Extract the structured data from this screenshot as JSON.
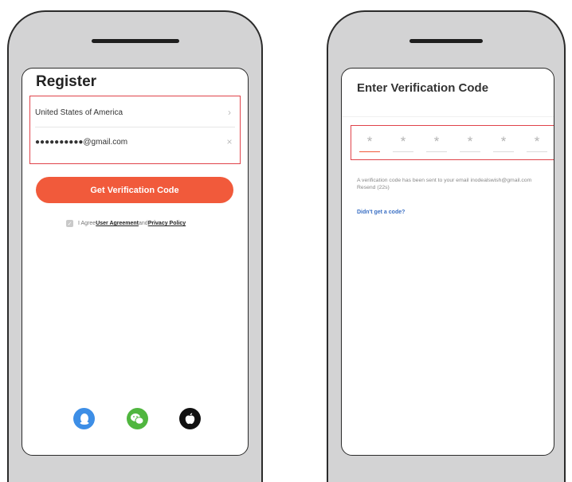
{
  "register": {
    "title": "Register",
    "country": "United States of America",
    "country_chevron": "›",
    "email": "●●●●●●●●●●@gmail.com",
    "clear_icon": "×",
    "get_code_label": "Get Verification Code",
    "agree_prefix": "I Agree",
    "user_agreement": "User Agreement",
    "and": "and",
    "privacy_policy": "Privacy Policy",
    "social_icons": [
      "qq-icon",
      "wechat-icon",
      "apple-icon"
    ]
  },
  "verify": {
    "title": "Enter Verification Code",
    "digits": [
      "*",
      "*",
      "*",
      "*",
      "*",
      "*"
    ],
    "sent_message": "A verification code has been sent to your email inodealswish@gmail.com Resend (22s)",
    "help_link": "Didn't get a code?"
  },
  "colors": {
    "accent": "#f15a3b",
    "highlight_box": "#e0434a",
    "link": "#3a6fc4"
  }
}
